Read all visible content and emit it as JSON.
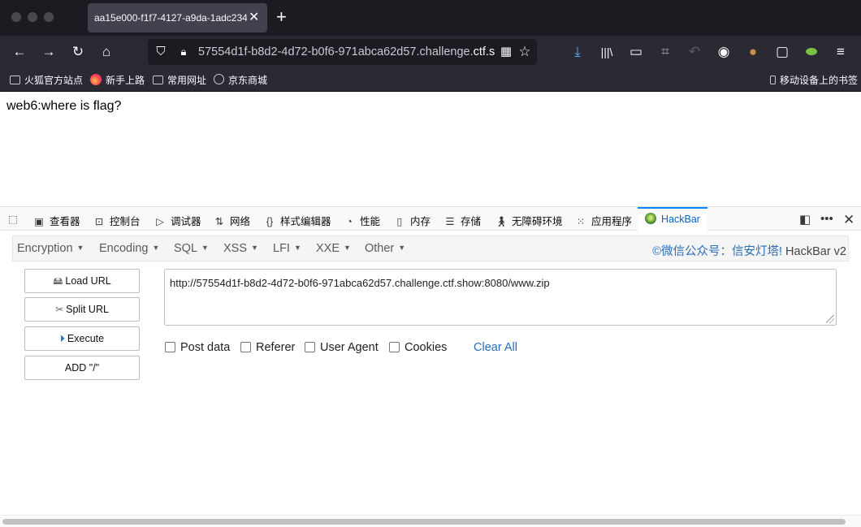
{
  "tab": {
    "title": "aa15e000-f1f7-4127-a9da-1adc234",
    "close": "✕"
  },
  "navbar": {
    "url_prefix": "57554d1f-b8d2-4d72-b0f6-971abca62d57.challenge.",
    "url_domain": "ctf.s"
  },
  "bookmarks": [
    {
      "label": "火狐官方站点"
    },
    {
      "label": "新手上路"
    },
    {
      "label": "常用网址"
    },
    {
      "label": "京东商城"
    }
  ],
  "bookmarks_right": "移动设备上的书签",
  "page": {
    "text": "web6:where is flag?"
  },
  "devtools": {
    "tabs": [
      "查看器",
      "控制台",
      "调试器",
      "网络",
      "样式编辑器",
      "性能",
      "内存",
      "存储",
      "无障碍环境",
      "应用程序",
      "HackBar"
    ]
  },
  "hackbar": {
    "menu": [
      "Encryption",
      "Encoding",
      "SQL",
      "XSS",
      "LFI",
      "XXE",
      "Other"
    ],
    "brand_prefix": "©微信公众号：信安灯塔!",
    "brand_suffix": " HackBar v2",
    "buttons": [
      "Load URL",
      "Split URL",
      "Execute",
      "ADD \"/\""
    ],
    "url_value": "http://57554d1f-b8d2-4d72-b0f6-971abca62d57.challenge.ctf.show:8080/www.zip",
    "checkboxes": [
      "Post data",
      "Referer",
      "User Agent",
      "Cookies"
    ],
    "clear_all": "Clear All"
  }
}
